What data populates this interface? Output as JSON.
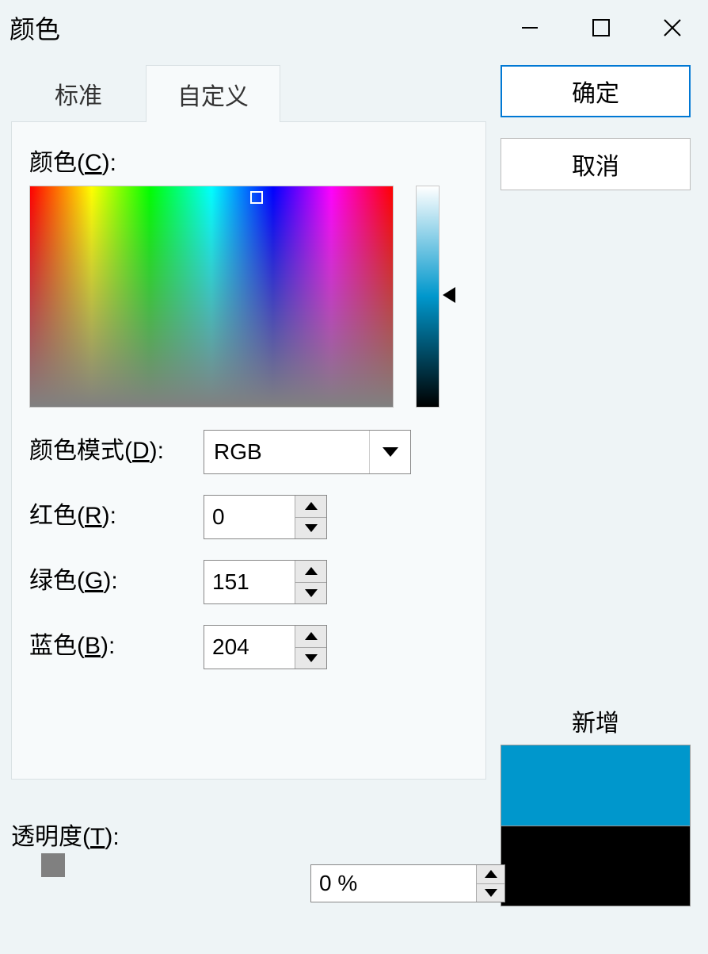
{
  "titlebar": {
    "title": "颜色"
  },
  "tabs": {
    "standard": "标准",
    "custom": "自定义",
    "active": "custom"
  },
  "labels": {
    "colors": "颜色(C):",
    "colorModel": "颜色模式(D):",
    "red": "红色(R):",
    "green": "绿色(G):",
    "blue": "蓝色(B):",
    "transparency": "透明度(T):",
    "new": "新增"
  },
  "colorModel": {
    "selected": "RGB"
  },
  "values": {
    "red": "0",
    "green": "151",
    "blue": "204",
    "transparency": "0 %"
  },
  "buttons": {
    "ok": "确定",
    "cancel": "取消"
  },
  "swatches": {
    "new_color": "#0097cc",
    "current_color": "#000000"
  }
}
